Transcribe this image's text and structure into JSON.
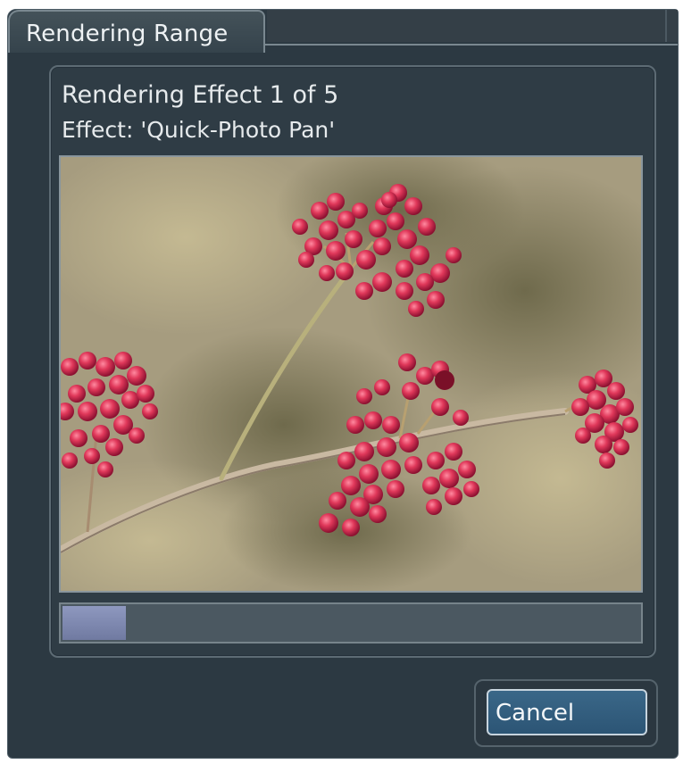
{
  "window": {
    "tab_title": "Rendering Range"
  },
  "status": {
    "progress_line": "Rendering Effect 1 of 5",
    "effect_line": "Effect: 'Quick-Photo Pan'"
  },
  "preview": {
    "subject": "red berry cluster on branch"
  },
  "progress": {
    "fraction": 0.11
  },
  "buttons": {
    "cancel_label": "Cancel"
  },
  "colors": {
    "panel_bg": "#2c3942",
    "progress_fill": "#7f89b0",
    "button_accent": "#2f5a7b"
  }
}
